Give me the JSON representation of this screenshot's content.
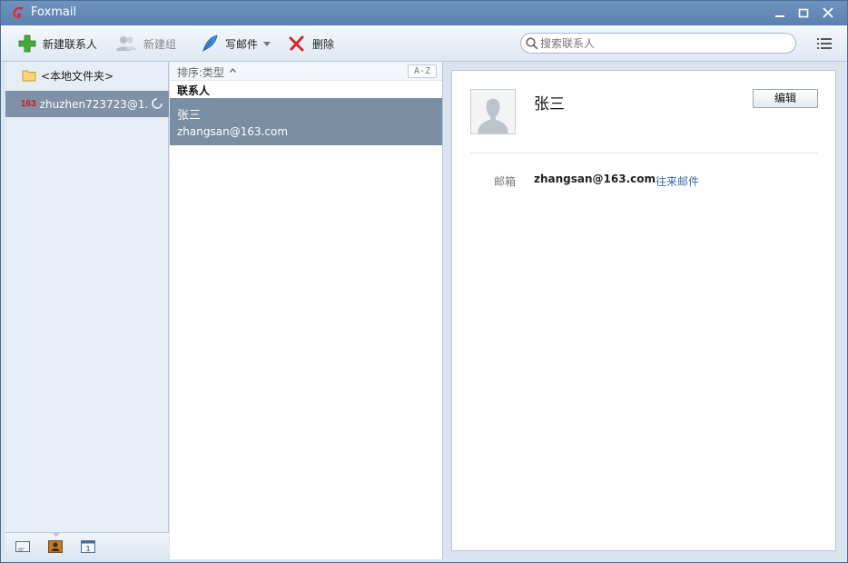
{
  "window": {
    "title": "Foxmail"
  },
  "toolbar": {
    "new_contact": "新建联系人",
    "new_group": "新建组",
    "write_mail": "写邮件",
    "delete": "删除",
    "search_placeholder": "搜索联系人"
  },
  "sidebar": {
    "local_folder": "<本地文件夹>",
    "account_badge": "163",
    "account": "zhuzhen723723@1..."
  },
  "list": {
    "sort_label": "排序:类型",
    "az": "A-Z",
    "group": "联系人",
    "contacts": [
      {
        "name": "张三",
        "email": "zhangsan@163.com"
      }
    ]
  },
  "detail": {
    "name": "张三",
    "edit": "编辑",
    "email_label": "邮箱",
    "email": "zhangsan@163.com",
    "history_link": "往来邮件"
  },
  "colors": {
    "titlebar": "#6085b1",
    "selection": "#7a8ea3",
    "link": "#3a6ea5"
  }
}
